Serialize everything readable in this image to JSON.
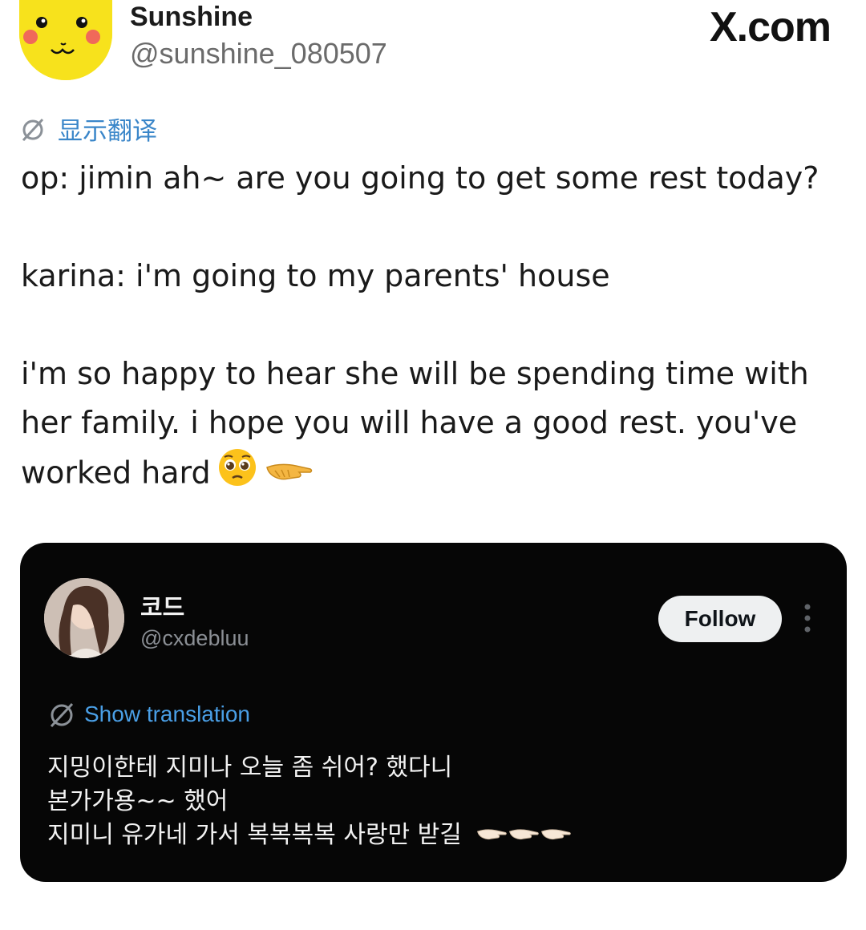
{
  "author": {
    "display_name": "Sunshine",
    "handle": "@sunshine_080507",
    "avatar_icon": "yellow-character-face"
  },
  "brand": "X.com",
  "post": {
    "translate_label": "显示翻译",
    "lines": [
      "op: jimin ah~ are you going to get some rest today?",
      "",
      "karina: i'm going to my parents' house",
      "",
      "i'm so happy to hear she will be spending time with",
      "her family. i hope you will have a good rest. you've",
      "worked hard"
    ],
    "emojis": [
      "pleading-face-emoji",
      "pointing-hand-emoji"
    ]
  },
  "embedded": {
    "display_name": "코드",
    "handle": "@cxdebluu",
    "follow_label": "Follow",
    "translate_label": "Show translation",
    "lines": [
      "지밍이한테 지미나 오늘 좀 쉬어? 했다니",
      "본가가용~~ 했어",
      "지미니 유가네 가서 복복복복 사랑만 받길"
    ],
    "emojis": [
      "pointing-hand-emoji",
      "pointing-hand-emoji",
      "pointing-hand-emoji"
    ]
  },
  "colors": {
    "link_blue": "#3a86c9",
    "card_background": "#060606",
    "avatar_yellow": "#f7e21c"
  }
}
